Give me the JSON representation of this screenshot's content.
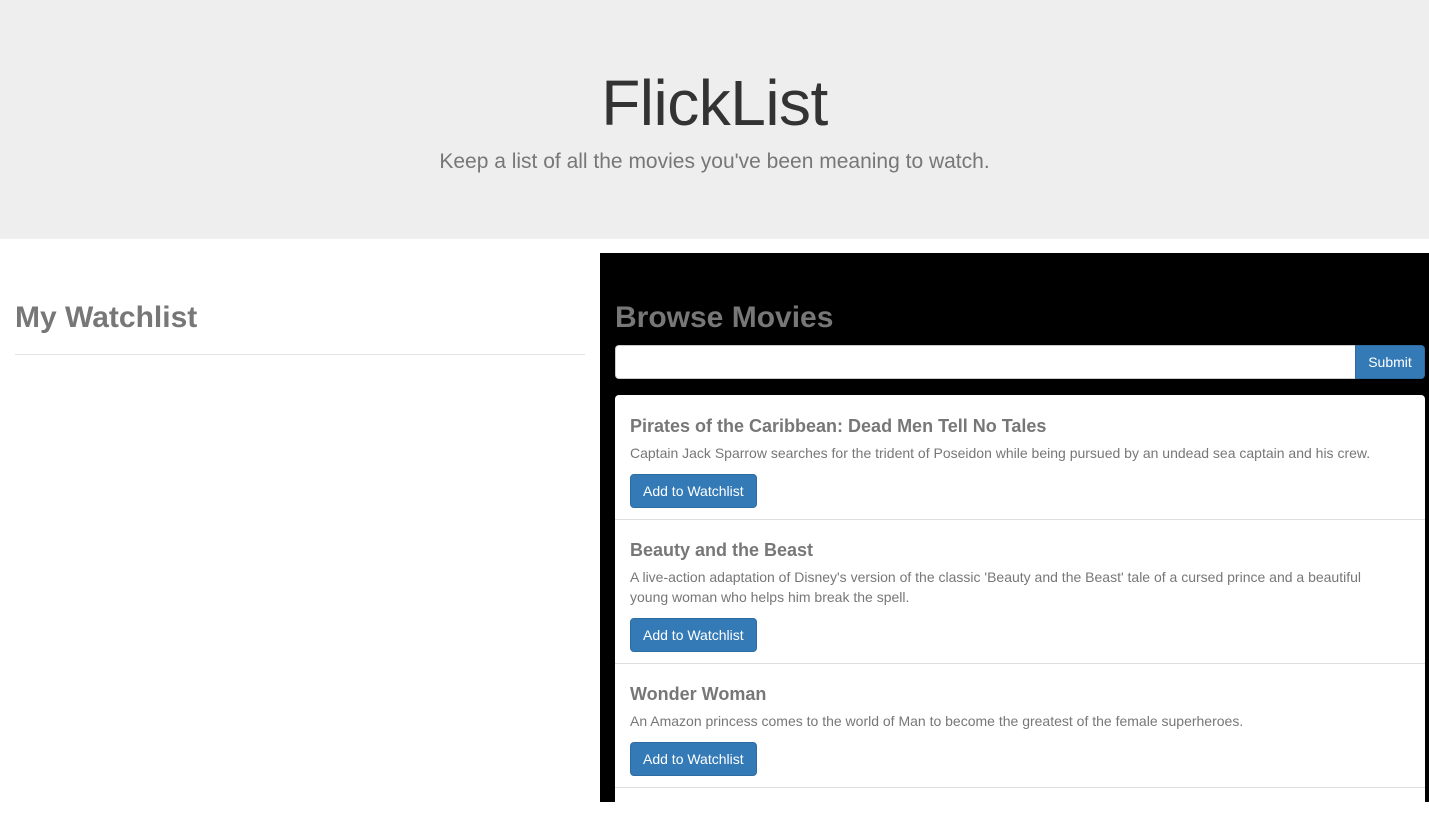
{
  "header": {
    "title": "FlickList",
    "tagline": "Keep a list of all the movies you've been meaning to watch."
  },
  "watchlist": {
    "heading": "My Watchlist"
  },
  "browse": {
    "heading": "Browse Movies",
    "search": {
      "value": "",
      "placeholder": ""
    },
    "submit_label": "Submit",
    "movies": [
      {
        "title": "Pirates of the Caribbean: Dead Men Tell No Tales",
        "overview": "Captain Jack Sparrow searches for the trident of Poseidon while being pursued by an undead sea captain and his crew.",
        "button_label": "Add to Watchlist"
      },
      {
        "title": "Beauty and the Beast",
        "overview": "A live-action adaptation of Disney's version of the classic 'Beauty and the Beast' tale of a cursed prince and a beautiful young woman who helps him break the spell.",
        "button_label": "Add to Watchlist"
      },
      {
        "title": "Wonder Woman",
        "overview": "An Amazon princess comes to the world of Man to become the greatest of the female superheroes.",
        "button_label": "Add to Watchlist"
      }
    ]
  },
  "colors": {
    "jumbotron_bg": "#eeeeee",
    "browse_panel_bg": "#000000",
    "primary": "#337ab7",
    "muted_text": "#777777",
    "title_text": "#333333"
  }
}
